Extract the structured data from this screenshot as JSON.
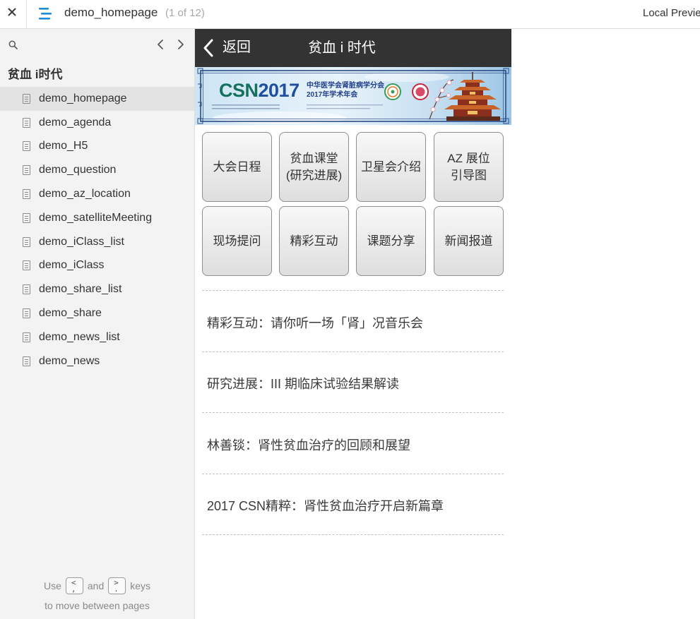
{
  "topbar": {
    "close_icon": "close-icon",
    "menu_icon": "hamburger-menu-icon",
    "page_title": "demo_homepage",
    "page_count": "(1 of 12)",
    "right_label": "Local Previe"
  },
  "sidebar": {
    "search_icon": "search-icon",
    "prev_icon": "chevron-left-icon",
    "next_icon": "chevron-right-icon",
    "project_title": "贫血 i时代",
    "selected_index": 0,
    "pages": [
      {
        "name": "demo_homepage"
      },
      {
        "name": "demo_agenda"
      },
      {
        "name": "demo_H5"
      },
      {
        "name": "demo_question"
      },
      {
        "name": "demo_az_location"
      },
      {
        "name": "demo_satelliteMeeting"
      },
      {
        "name": "demo_iClass_list"
      },
      {
        "name": "demo_iClass"
      },
      {
        "name": "demo_share_list"
      },
      {
        "name": "demo_share"
      },
      {
        "name": "demo_news_list"
      },
      {
        "name": "demo_news"
      }
    ],
    "hint": {
      "use": "Use",
      "and": "and",
      "keys": "keys",
      "line2": "to move between pages",
      "prev_key": {
        "top": "<",
        "bottom": ","
      },
      "next_key": {
        "top": ">",
        "bottom": "."
      }
    }
  },
  "prototype": {
    "header": {
      "back_icon": "chevron-left-icon",
      "back_label": "返回",
      "title": "贫血 i 时代"
    },
    "banner": {
      "csn": "CSN",
      "year": "2017",
      "org": "中华医学会肾脏病学分会",
      "event": "2017年学术年会"
    },
    "menu_buttons": [
      {
        "label": "大会日程"
      },
      {
        "label": "贫血课堂\n(研究进展)"
      },
      {
        "label": "卫星会介绍"
      },
      {
        "label": "AZ 展位\n引导图"
      },
      {
        "label": "现场提问"
      },
      {
        "label": "精彩互动"
      },
      {
        "label": "课题分享"
      },
      {
        "label": "新闻报道"
      }
    ],
    "news": [
      {
        "title": "精彩互动：请你听一场「肾」况音乐会"
      },
      {
        "title": "研究进展：III 期临床试验结果解读"
      },
      {
        "title": "林善锬：肾性贫血治疗的回顾和展望"
      },
      {
        "title": "2017 CSN精粹：肾性贫血治疗开启新篇章"
      }
    ]
  },
  "colors": {
    "accent": "#1b8ed6",
    "proto_header_bg": "#333333",
    "sidebar_bg": "#f3f3f3",
    "selected_row_bg": "#e3e3e3"
  }
}
